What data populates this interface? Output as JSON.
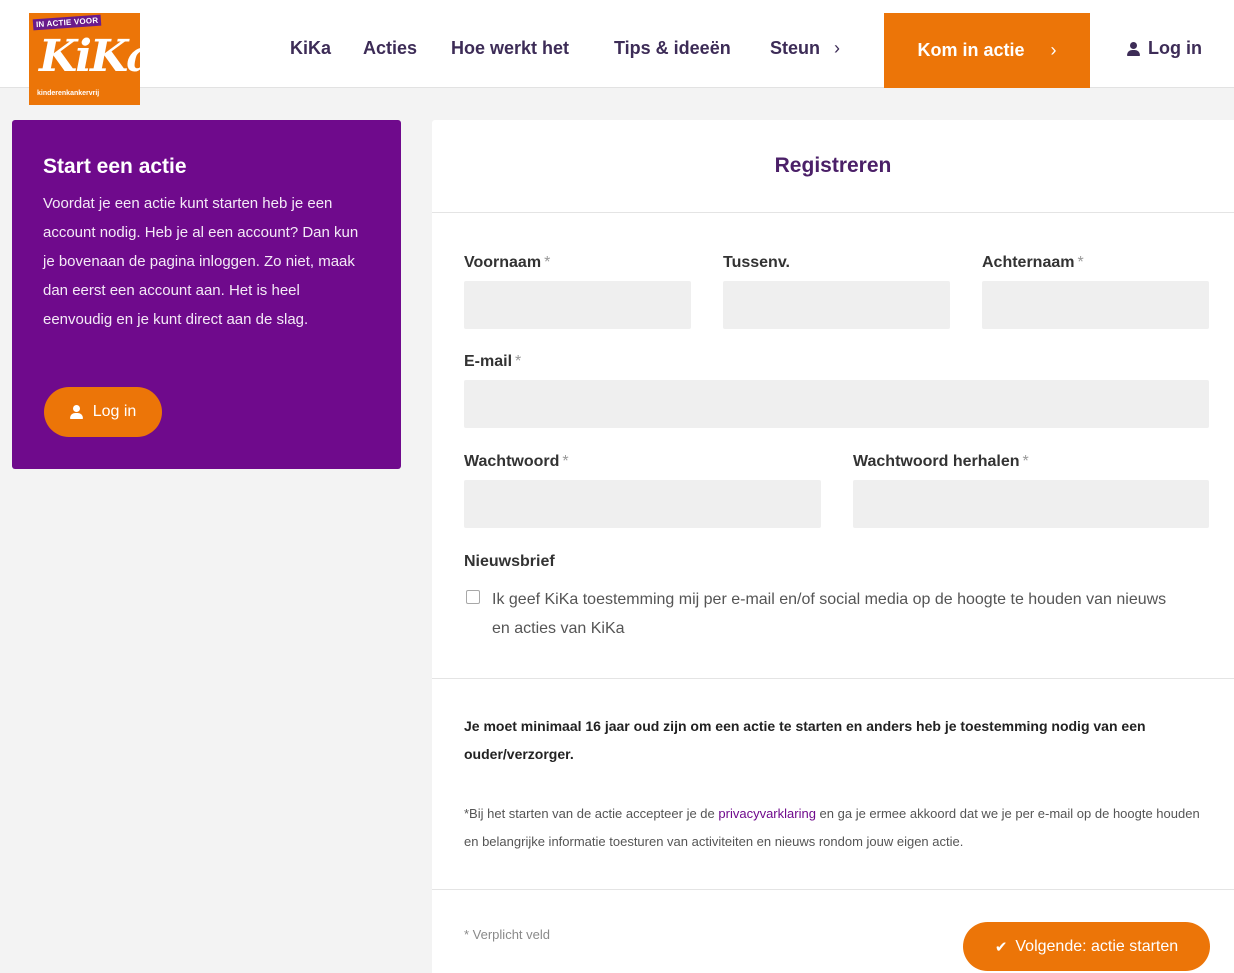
{
  "header": {
    "logo": {
      "tag": "IN ACTIE VOOR",
      "word": "KiKa",
      "sub": "kinderenkankervrij"
    },
    "nav": [
      "KiKa",
      "Acties",
      "Hoe werkt het",
      "Tips & ideeën",
      "Steun"
    ],
    "steun_chevron": "›",
    "cta_label": "Kom in actie",
    "cta_chevron": "›",
    "login_label": "Log in"
  },
  "sidebar": {
    "title": "Start een actie",
    "text": "Voordat je een actie kunt starten heb je een account nodig. Heb je al een account? Dan kun je bovenaan de pagina inloggen. Zo niet, maak dan eerst een account aan. Het is heel eenvoudig en je kunt direct aan de slag.",
    "login_label": "Log in"
  },
  "form": {
    "title": "Registreren",
    "required_mark": "*",
    "fields": {
      "voornaam": {
        "label": "Voornaam",
        "value": ""
      },
      "tussenv": {
        "label": "Tussenv.",
        "value": ""
      },
      "achternaam": {
        "label": "Achternaam",
        "value": ""
      },
      "email": {
        "label": "E-mail",
        "value": ""
      },
      "wachtwoord": {
        "label": "Wachtwoord",
        "value": ""
      },
      "wachtwoord_herhalen": {
        "label": "Wachtwoord herhalen",
        "value": ""
      }
    },
    "newsletter": {
      "label": "Nieuwsbrief",
      "checkbox_text": "Ik geef KiKa toestemming mij per e-mail en/of social media op de hoogte te houden van nieuws en acties van KiKa",
      "checked": false
    },
    "age_warning": "Je moet minimaal 16 jaar oud zijn om een actie te starten en anders heb je toestemming nodig van een ouder/verzorger.",
    "privacy_before": "*Bij het starten van de actie accepteer je de ",
    "privacy_link": "privacyvarklaring",
    "privacy_after": " en ga je ermee akkoord dat we je per e-mail op de hoogte houden en belangrijke informatie toesturen van activiteiten en nieuws rondom jouw eigen actie.",
    "required_note": "* Verplicht veld",
    "next_label": "Volgende: actie starten"
  },
  "colors": {
    "orange": "#ec7508",
    "purple": "#6f0a8c",
    "nav_text": "#3d2c57"
  }
}
